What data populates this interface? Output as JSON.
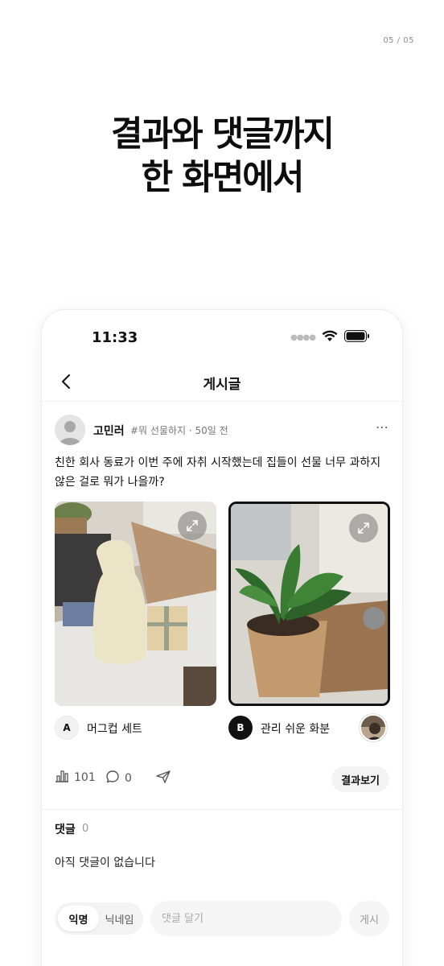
{
  "page_indicator": "05 / 05",
  "headline": {
    "line1": "결과와 댓글까지",
    "line2": "한 화면에서"
  },
  "status_bar": {
    "time": "11:33"
  },
  "nav": {
    "title": "게시글"
  },
  "post": {
    "author": "고민러",
    "meta": "#뭐 선물하지 · 50일 전",
    "body": "친한 회사 동료가 이번 주에 자취 시작했는데 집들이 선물 너무 과하지 않은 걸로 뭐가 나을까?",
    "options": [
      {
        "letter": "A",
        "label": "머그컵 세트"
      },
      {
        "letter": "B",
        "label": "관리 쉬운 화분"
      }
    ]
  },
  "actions": {
    "views": "101",
    "comments": "0",
    "result_button": "결과보기"
  },
  "comments": {
    "title": "댓글",
    "count": "0",
    "empty_text": "아직 댓글이 없습니다"
  },
  "comment_bar": {
    "toggle_anonymous": "익명",
    "toggle_nickname": "닉네임",
    "placeholder": "댓글 달기",
    "submit": "게시"
  },
  "colors": {
    "selected_border": "#111111",
    "muted_bg": "#f3f3f3"
  }
}
